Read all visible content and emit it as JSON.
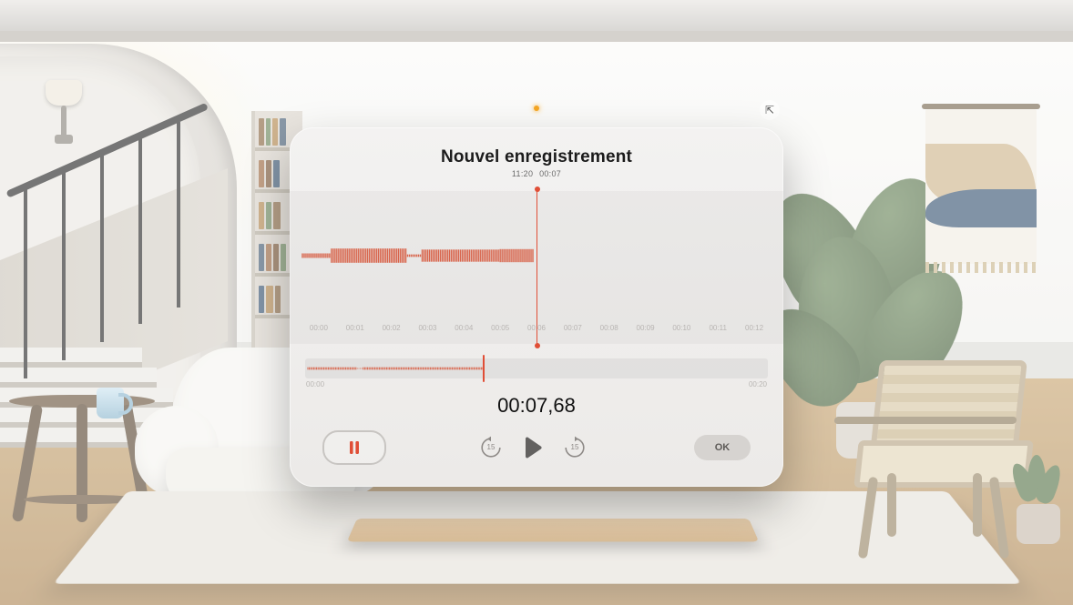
{
  "header": {
    "title": "Nouvel enregistrement",
    "clock": "11:20",
    "duration": "00:07"
  },
  "timeline": {
    "ticks": [
      "00:00",
      "00:01",
      "00:02",
      "00:03",
      "00:04",
      "00:05",
      "00:06",
      "00:07",
      "00:08",
      "00:09",
      "00:10",
      "00:11",
      "00:12"
    ]
  },
  "overview": {
    "start_label": "00:00",
    "end_label": "00:20",
    "playhead_fraction": 0.383
  },
  "elapsed": "00:07,68",
  "controls": {
    "pause_label": "Pause",
    "skip_back_seconds": "15",
    "skip_fwd_seconds": "15",
    "play_label": "Lecture",
    "ok_label": "OK"
  },
  "portal": {
    "pip_glyph": "⇱"
  }
}
